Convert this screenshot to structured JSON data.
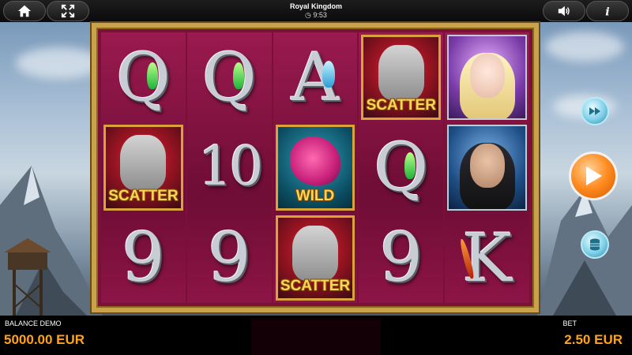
{
  "header": {
    "game_title": "Royal Kingdom",
    "clock": "9:53",
    "home_icon": "home-icon",
    "fullscreen_icon": "fullscreen-icon",
    "sound_icon": "speaker-icon",
    "info_icon": "info-icon"
  },
  "reels": [
    [
      "Q",
      "SCATTER",
      "9"
    ],
    [
      "Q",
      "10",
      "9"
    ],
    [
      "A",
      "WILD",
      "SCATTER"
    ],
    [
      "SCATTER",
      "Q",
      "9"
    ],
    [
      "princess",
      "knight",
      "K"
    ]
  ],
  "symbols": {
    "scatter_label": "SCATTER",
    "wild_label": "WILD"
  },
  "controls": {
    "fast_forward_icon": "fast-forward-icon",
    "spin_icon": "play-icon",
    "coins_icon": "coins-icon"
  },
  "footer": {
    "balance_label": "BALANCE  DEMO",
    "balance_value": "5000.00 EUR",
    "bet_label": "BET",
    "bet_value": "2.50 EUR"
  },
  "colors": {
    "accent_orange": "#ffa21c",
    "reel_background": "#7a1038",
    "frame_gold": "#c9a24c"
  }
}
